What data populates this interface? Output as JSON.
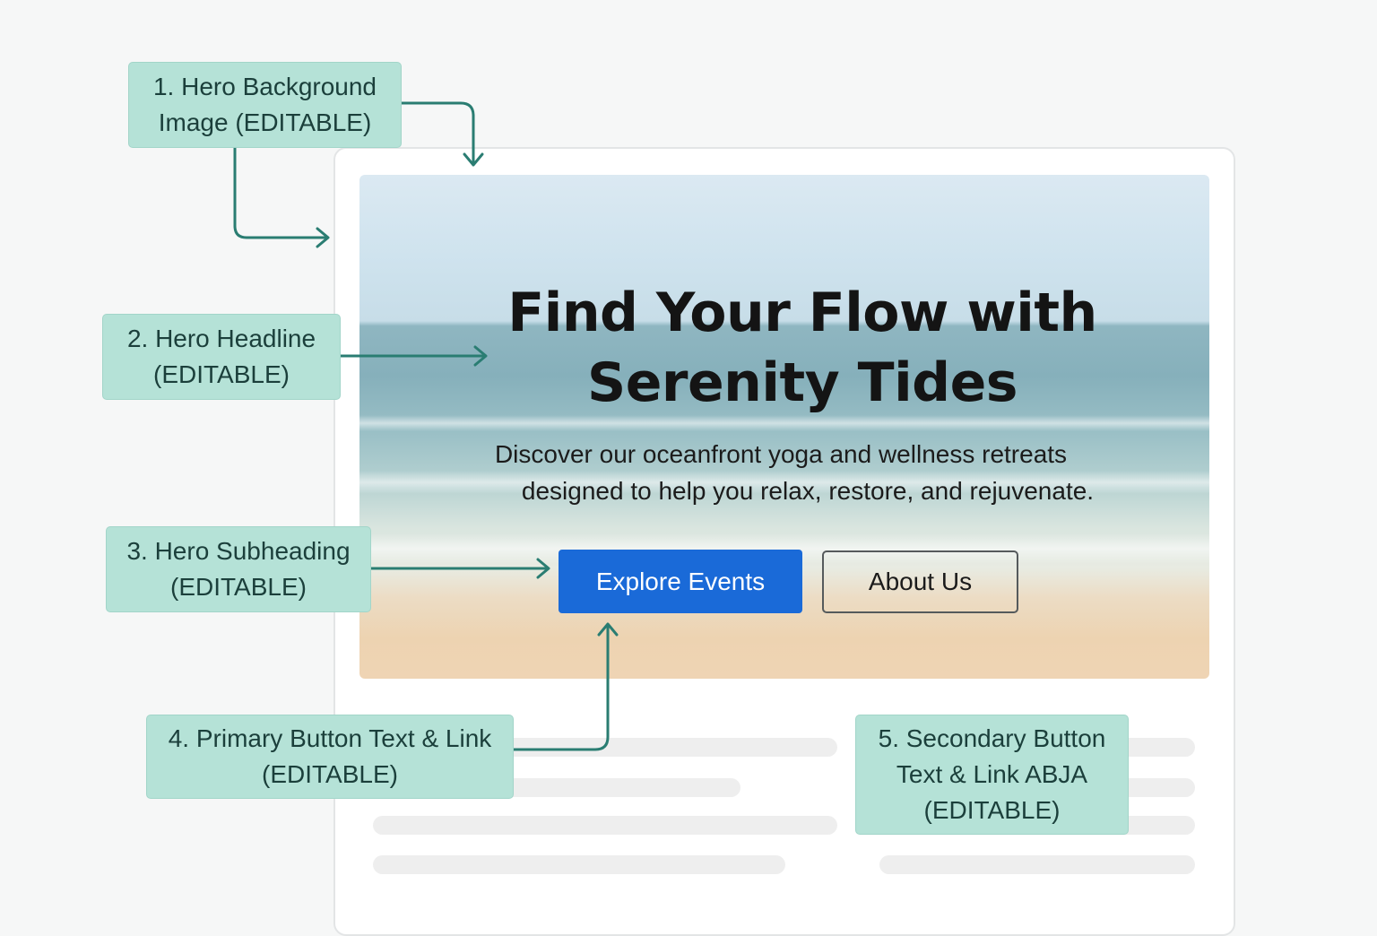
{
  "colors": {
    "primary_button": "#1a6ad8",
    "callout_fill": "#b5e2d7",
    "arrow": "#2a7d72",
    "headline_text": "#141414"
  },
  "hero": {
    "background_image": "beach-ocean-photo",
    "headline": [
      "Find Your Flow with",
      "Serenity Tides"
    ],
    "subheading": [
      "Discover our oceanfront yoga and wellness retreats",
      "designed to help you relax, restore, and rejuvenate."
    ],
    "primary_button_label": "Explore Events",
    "secondary_button_label": "About Us"
  },
  "callouts": [
    {
      "lines": [
        "1. Hero Background",
        "Image (EDITABLE)"
      ]
    },
    {
      "lines": [
        "2. Hero Headline",
        "(EDITABLE)"
      ]
    },
    {
      "lines": [
        "3. Hero Subheading",
        "(EDITABLE)"
      ]
    },
    {
      "lines": [
        "4. Primary Button Text & Link",
        "(EDITABLE)"
      ]
    },
    {
      "lines": [
        "5. Secondary Button",
        "Text & Link ABJA",
        "(EDITABLE)"
      ]
    }
  ]
}
